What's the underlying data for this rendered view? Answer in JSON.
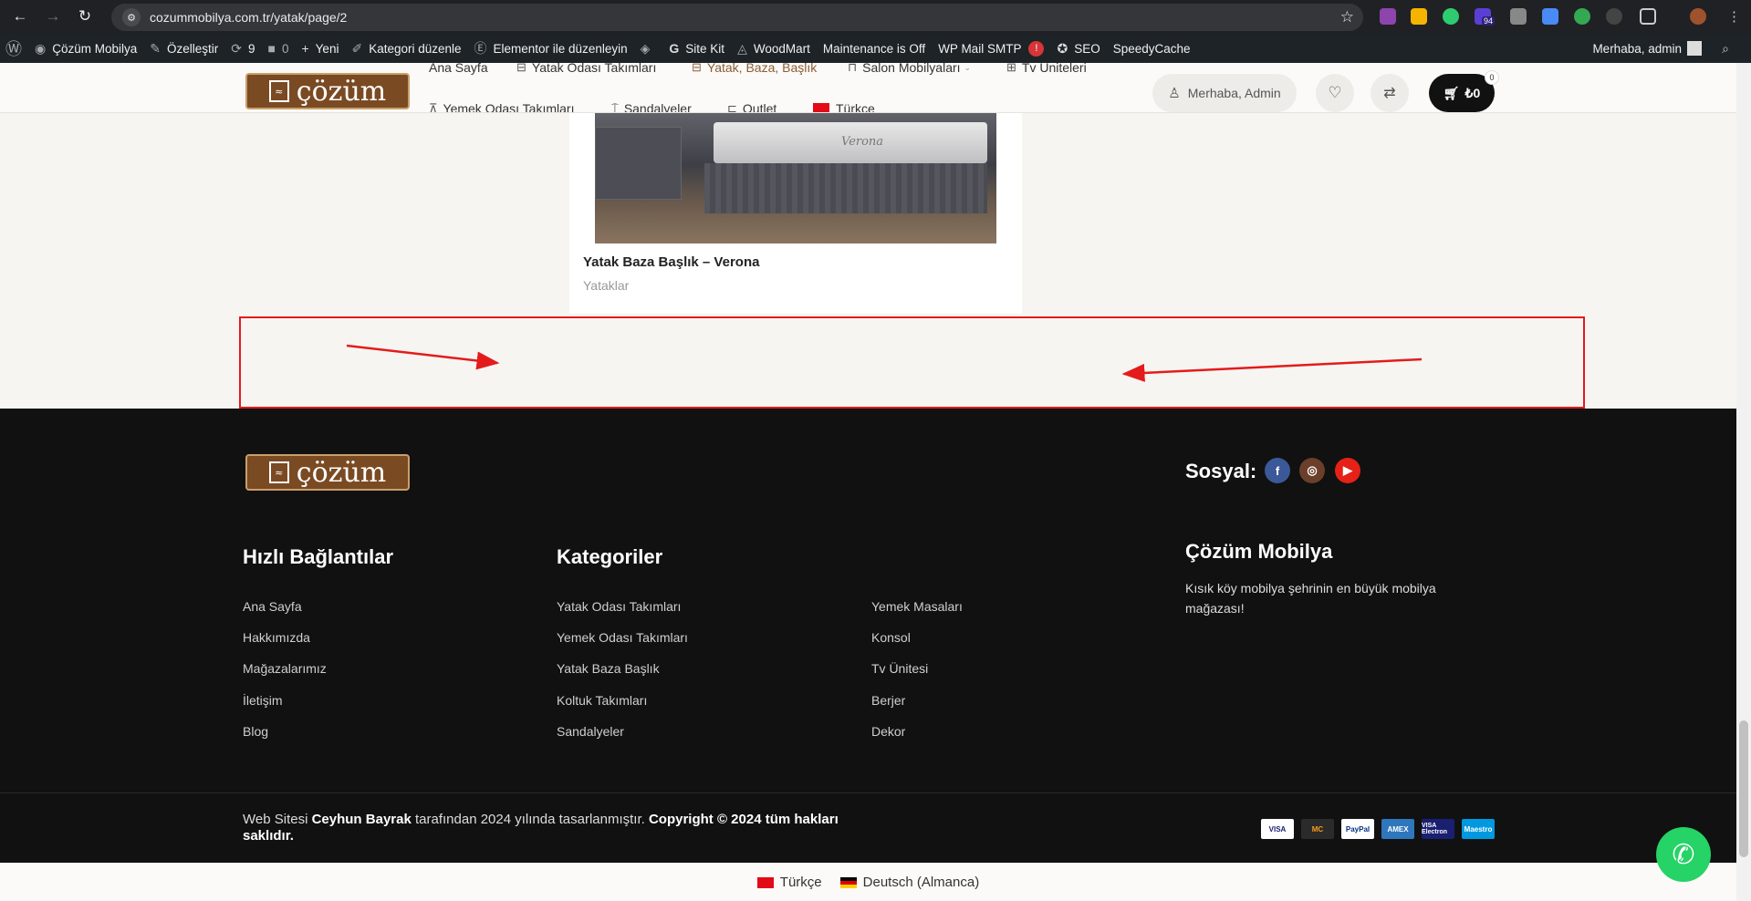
{
  "browser": {
    "url": "cozummobilya.com.tr/yatak/page/2",
    "badge_count": "94"
  },
  "wp_admin_bar": {
    "items": [
      {
        "icon": "wordpress-icon",
        "label": ""
      },
      {
        "icon": "dashboard-icon",
        "label": "Çözüm Mobilya"
      },
      {
        "icon": "brush-icon",
        "label": "Özelleştir"
      },
      {
        "icon": "updates-icon",
        "label": "9"
      },
      {
        "icon": "comments-icon",
        "label": "0"
      },
      {
        "icon": "plus-icon",
        "label": "Yeni"
      },
      {
        "icon": "pencil-icon",
        "label": "Kategori düzenle"
      },
      {
        "icon": "elementor-icon",
        "label": "Elementor ile düzenleyin"
      },
      {
        "icon": "diamond-icon",
        "label": ""
      },
      {
        "icon": "google-icon",
        "label": "Site Kit"
      },
      {
        "icon": "woodmart-icon",
        "label": "WoodMart"
      },
      {
        "icon": "",
        "label": "Maintenance is Off"
      },
      {
        "icon": "",
        "label": "WP Mail SMTP"
      },
      {
        "icon": "seo-icon",
        "label": "SEO"
      },
      {
        "icon": "",
        "label": "SpeedyCache"
      }
    ],
    "smtp_alert": "!",
    "greeting": "Merhaba, admin"
  },
  "header": {
    "logo_text": "çözüm",
    "menu": {
      "ana_sayfa": "Ana Sayfa",
      "yatak_odasi": "Yatak Odası Takımları",
      "yatak_baza": "Yatak, Baza, Başlık",
      "salon": "Salon Mobilyaları",
      "tv": "Tv Üniteleri",
      "yemek_odasi": "Yemek Odası Takımları",
      "sandalyeler": "Sandalyeler",
      "outlet": "Outlet",
      "dil": "Türkçe"
    },
    "account": "Merhaba, Admin",
    "cart_total": "₺0",
    "cart_count": "0"
  },
  "product": {
    "title": "Yatak Baza Başlık – Verona",
    "category": "Yataklar",
    "image_brand": "Verona"
  },
  "footer": {
    "logo_text": "çözüm",
    "social_label": "Sosyal:",
    "quick_links_title": "Hızlı Bağlantılar",
    "quick_links": [
      "Ana Sayfa",
      "Hakkımızda",
      "Mağazalarımız",
      "İletişim",
      "Blog"
    ],
    "categories_title": "Kategoriler",
    "categories_col1": [
      "Yatak Odası Takımları",
      "Yemek Odası Takımları",
      "Yatak Baza Başlık",
      "Koltuk Takımları",
      "Sandalyeler"
    ],
    "categories_col2": [
      "Yemek Masaları",
      "Konsol",
      "Tv Ünitesi",
      "Berjer",
      "Dekor"
    ],
    "about_title": "Çözüm Mobilya",
    "about_text": "Kısık köy mobilya şehrinin en büyük mobilya mağazası!",
    "copyright_prefix": "Web Sitesi ",
    "copyright_author": "Ceyhun Bayrak",
    "copyright_middle": " tarafından 2024 yılında tasarlanmıştır. ",
    "copyright_bold": "Copyright © 2024 tüm hakları saklıdır.",
    "payments": [
      "VISA",
      "MC",
      "PayPal",
      "AMEX",
      "VISA Electron",
      "Maestro"
    ]
  },
  "language_switcher": {
    "turkish": "Türkçe",
    "german": "Deutsch (Almanca)"
  },
  "colors": {
    "brand_brown": "#7a4a23",
    "annotation_red": "#e41b1b",
    "footer_bg": "#111111",
    "whatsapp_green": "#25d366"
  }
}
